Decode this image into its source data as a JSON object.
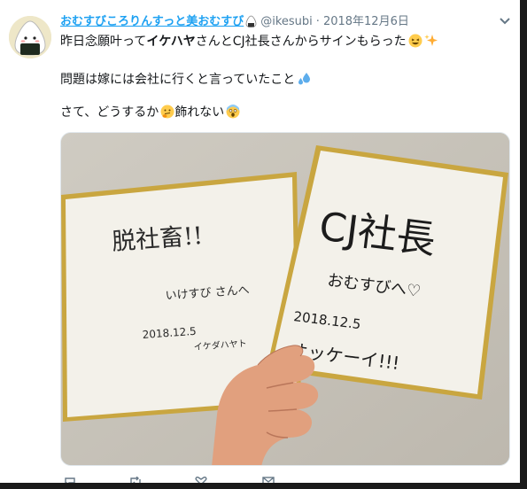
{
  "tweet": {
    "display_name": "おむすびころりんすっと美おむすび",
    "handle": "@ikesubi",
    "separator": "·",
    "date": "2018年12月6日",
    "line1_prefix": "昨日念願叶って",
    "line1_bold": "イケハヤ",
    "line1_suffix": "さんとCJ社長さんからサインもらった",
    "line2": "問題は嫁には会社に行くと言っていたこと",
    "line3_prefix": "さて、どうするか",
    "line3_suffix": "飾れない"
  },
  "photo": {
    "left_board": {
      "title": "脱社畜!!",
      "name": "いけすび さんへ",
      "date": "2018.12.5",
      "signature": "イケダハヤト"
    },
    "right_board": {
      "title": "CJ社長",
      "name": "おむすびへ♡",
      "date": "2018.12.5",
      "exclaim": "オッケーイ!!!"
    }
  },
  "icons": [
    "avatar-onigiri",
    "onigiri-emoji",
    "chevron-down-icon",
    "laughing-emoji",
    "sparkles-emoji",
    "sweat-droplets-emoji",
    "thinking-emoji",
    "scream-emoji",
    "reply-icon",
    "retweet-icon",
    "like-icon",
    "message-icon"
  ],
  "colors": {
    "link": "#1da1f2",
    "muted": "#657786",
    "text": "#14171a",
    "frame": "#1a1a1a"
  }
}
